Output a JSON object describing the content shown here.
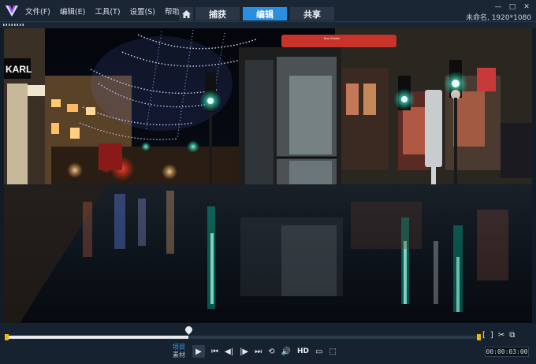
{
  "app": {
    "logo_icon": "videostudio-logo",
    "project_info": "未命名, 1920*1080",
    "window_controls": [
      "—",
      "□",
      "✕"
    ]
  },
  "menu": {
    "items": [
      {
        "label": "文件(F)"
      },
      {
        "label": "编辑(E)"
      },
      {
        "label": "工具(T)"
      },
      {
        "label": "设置(S)"
      },
      {
        "label": "帮助(H)"
      }
    ]
  },
  "tabs": [
    {
      "label": "捕获",
      "active": false
    },
    {
      "label": "编辑",
      "active": true
    },
    {
      "label": "共享",
      "active": false
    }
  ],
  "viewer": {
    "scene": "night-street-photo",
    "scrub_progress": 0.385
  },
  "player": {
    "mode_project": "项目",
    "mode_clip": "素材",
    "hd_label": "HD",
    "timecode": "00:00:03:00",
    "trim_marks": [
      "[",
      "]"
    ],
    "buttons": {
      "play": "▶",
      "to_start": "⏮",
      "prev_frame": "◀|",
      "next_frame": "|▶",
      "to_end": "⏭",
      "repeat": "⟲",
      "volume": "🔊",
      "aspect": "▭",
      "expand": "⬚"
    }
  },
  "colors": {
    "accent": "#2a8fe0",
    "trim_handle": "#f5b800",
    "mode_active": "#3aa0ff"
  }
}
